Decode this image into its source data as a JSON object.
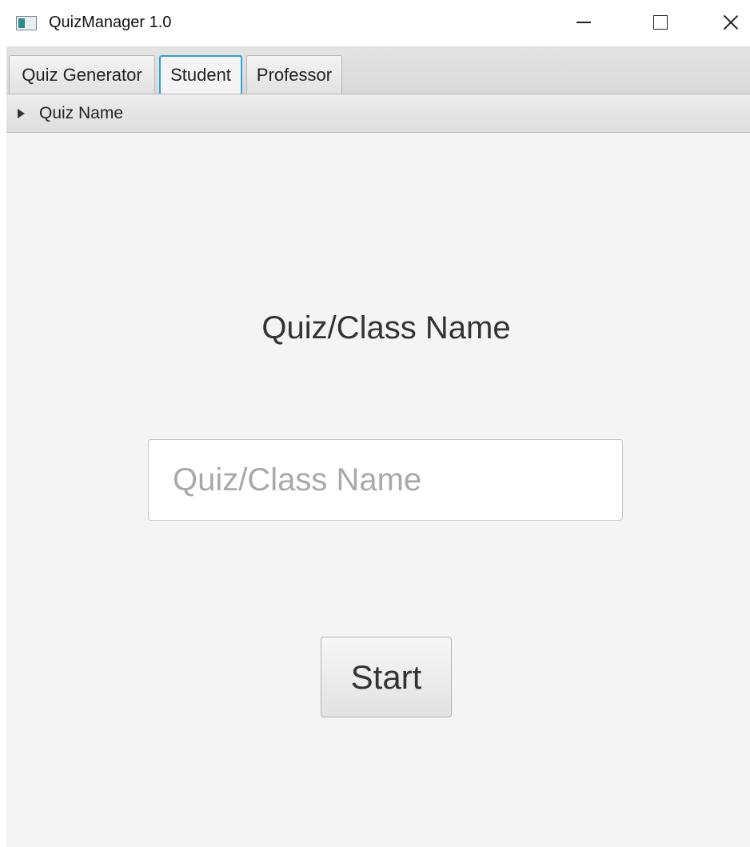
{
  "window": {
    "title": "QuizManager 1.0"
  },
  "icons": {
    "app": "app-window-icon",
    "minimize": "minimize-icon",
    "maximize": "maximize-icon",
    "close": "close-icon",
    "expand": "triangle-right-icon"
  },
  "tabs": [
    {
      "label": "Quiz Generator",
      "active": false
    },
    {
      "label": "Student",
      "active": true
    },
    {
      "label": "Professor",
      "active": false
    }
  ],
  "pane": {
    "label": "Quiz Name",
    "expanded": false
  },
  "form": {
    "heading": "Quiz/Class Name",
    "input_value": "",
    "input_placeholder": "Quiz/Class Name",
    "start_label": "Start"
  },
  "colors": {
    "active_tab_border": "#2ea3d6",
    "background": "#f4f4f4"
  }
}
